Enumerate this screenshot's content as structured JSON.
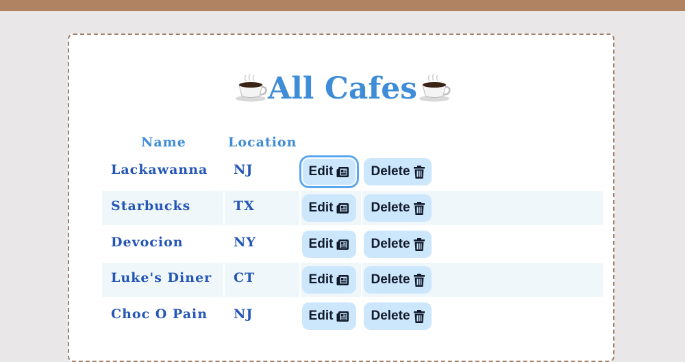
{
  "page": {
    "title": "All Cafes",
    "title_icon": "coffee-cup-icon"
  },
  "table": {
    "headers": [
      "Name",
      "Location"
    ],
    "rows": [
      {
        "name": "Lackawanna",
        "location": "NJ"
      },
      {
        "name": "Starbucks",
        "location": "TX"
      },
      {
        "name": "Devocion",
        "location": "NY"
      },
      {
        "name": "Luke's Diner",
        "location": "CT"
      },
      {
        "name": "Choc O Pain",
        "location": "NJ"
      }
    ],
    "edit_label": "Edit",
    "delete_label": "Delete",
    "edit_icon": "newspaper-icon",
    "delete_icon": "trash-icon"
  },
  "colors": {
    "topbar": "#b08463",
    "title": "#3f8dd6",
    "cell_text": "#2456b6",
    "button_bg": "#cce6fb",
    "stripe": "#f0f7fb"
  }
}
